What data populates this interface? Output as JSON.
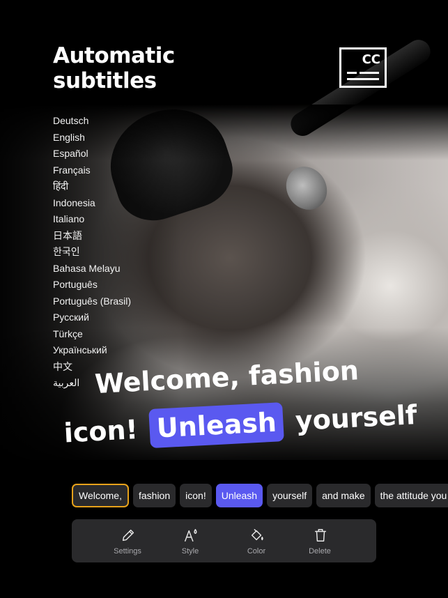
{
  "header": {
    "title_line1": "Automatic",
    "title_line2": "subtitles",
    "badge_text": "CC"
  },
  "languages": [
    "Deutsch",
    "English",
    "Español",
    "Français",
    "हिंदी",
    "Indonesia",
    "Italiano",
    "日本語",
    "한국인",
    "Bahasa Melayu",
    "Português",
    "Português (Brasil)",
    "Русский",
    "Türkçe",
    "Український",
    "中文",
    "العربية"
  ],
  "caption": {
    "line1": "Welcome, fashion",
    "line2_before": "icon!",
    "line2_highlight": "Unleash",
    "line2_after": "yourself"
  },
  "word_chips": [
    "Welcome,",
    "fashion",
    "icon!",
    "Unleash",
    "yourself",
    "and make",
    "the attitude you"
  ],
  "toolbar": {
    "settings_label": "Settings",
    "style_label": "Style",
    "color_label": "Color",
    "delete_label": "Delete"
  },
  "colors": {
    "accent": "#5a59f0",
    "selected_border": "#e7a21a",
    "panel": "#2a2a2c",
    "background": "#000000"
  }
}
